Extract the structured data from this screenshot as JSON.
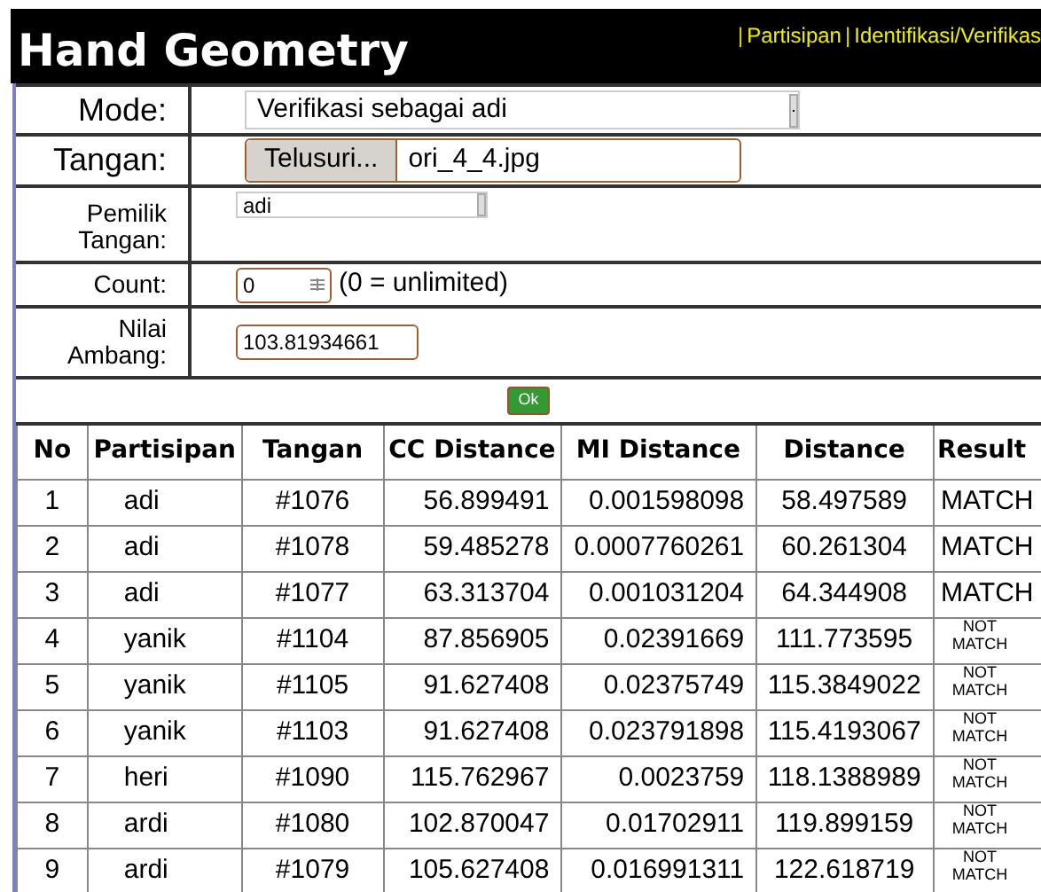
{
  "header": {
    "title": "Hand Geometry",
    "nav": [
      {
        "kind": "separator",
        "text": "|"
      },
      {
        "kind": "link",
        "text": "Partisipan"
      },
      {
        "kind": "separator",
        "text": "|"
      },
      {
        "kind": "link",
        "text": "Identifikasi/Verifikas"
      }
    ]
  },
  "form": {
    "mode": {
      "label": "Mode:",
      "value": "Verifikasi sebagai adi"
    },
    "tangan": {
      "label": "Tangan:",
      "button": "Telusuri...",
      "file": "ori_4_4.jpg"
    },
    "pemilik": {
      "label": "Pemilik Tangan:",
      "value": "adi"
    },
    "count": {
      "label": "Count:",
      "value": "0",
      "note": "(0 = unlimited)"
    },
    "ambang": {
      "label": "Nilai Ambang:",
      "value": "103.81934661"
    },
    "submit": "Ok"
  },
  "table": {
    "columns": [
      "No",
      "Partisipan",
      "Tangan",
      "CC Distance",
      "MI Distance",
      "Distance",
      "Result"
    ],
    "rows": [
      {
        "cells": [
          "1",
          "adi",
          "#1076",
          "56.899491",
          "0.001598098",
          "58.497589",
          "MATCH"
        ],
        "kind": "match"
      },
      {
        "cells": [
          "2",
          "adi",
          "#1078",
          "59.485278",
          "0.0007760261",
          "60.261304",
          "MATCH"
        ],
        "kind": "match"
      },
      {
        "cells": [
          "3",
          "adi",
          "#1077",
          "63.313704",
          "0.001031204",
          "64.344908",
          "MATCH"
        ],
        "kind": "match"
      },
      {
        "cells": [
          "4",
          "yanik",
          "#1104",
          "87.856905",
          "0.02391669",
          "111.773595",
          "NOT MATCH"
        ],
        "kind": "not_match"
      },
      {
        "cells": [
          "5",
          "yanik",
          "#1105",
          "91.627408",
          "0.02375749",
          "115.3849022",
          "NOT MATCH"
        ],
        "kind": "not_match"
      },
      {
        "cells": [
          "6",
          "yanik",
          "#1103",
          "91.627408",
          "0.023791898",
          "115.4193067",
          "NOT MATCH"
        ],
        "kind": "not_match"
      },
      {
        "cells": [
          "7",
          "heri",
          "#1090",
          "115.762967",
          "0.0023759",
          "118.1388989",
          "NOT MATCH"
        ],
        "kind": "not_match"
      },
      {
        "cells": [
          "8",
          "ardi",
          "#1080",
          "102.870047",
          "0.01702911",
          "119.899159",
          "NOT MATCH"
        ],
        "kind": "not_match"
      },
      {
        "cells": [
          "9",
          "ardi",
          "#1079",
          "105.627408",
          "0.016991311",
          "122.618719",
          "NOT MATCH"
        ],
        "kind": "not_match"
      }
    ]
  }
}
